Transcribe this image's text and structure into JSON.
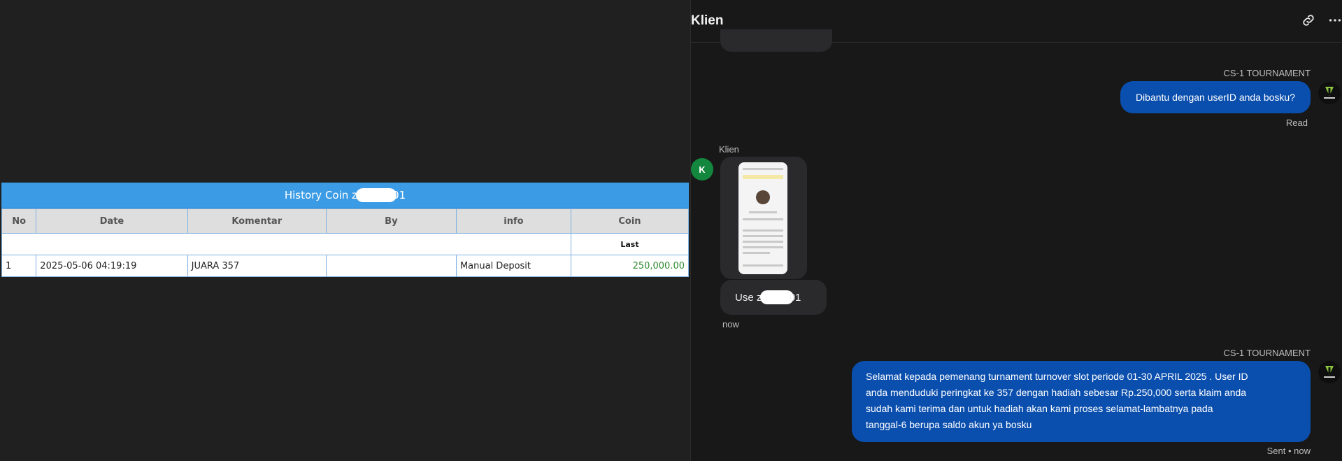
{
  "history": {
    "title_prefix": "History Coin zi",
    "title_suffix": "01",
    "columns": [
      "No",
      "Date",
      "Komentar",
      "By",
      "info",
      "Coin"
    ],
    "subheader": "Last",
    "rows": [
      {
        "no": "1",
        "date": "2025-05-06 04:19:19",
        "komentar": "JUARA 357",
        "by": "",
        "info": "Manual Deposit",
        "coin": "250,000.00"
      }
    ]
  },
  "chat": {
    "title": "Klien",
    "header_icons": [
      "link-icon",
      "more-icon"
    ],
    "messages": [
      {
        "sender": "CS-1 TOURNAMENT",
        "text": "Dibantu dengan userID anda bosku?",
        "status": "Read"
      },
      {
        "sender": "Klien",
        "avatar_letter": "K",
        "attachment": "phone-screenshot-image",
        "text_prefix": "Use zi",
        "text_suffix": "01",
        "time": "now"
      },
      {
        "sender": "CS-1 TOURNAMENT",
        "lines": [
          "Selamat kepada pemenang turnament turnover slot periode 01-30 APRIL 2025 . User ID",
          "anda menduduki peringkat ke 357 dengan hadiah sebesar Rp.250,000 serta klaim anda",
          "sudah kami terima dan untuk hadiah akan kami proses selamat-lambatnya pada",
          "tanggal-6 berupa saldo akun ya bosku"
        ],
        "status": "Sent • now"
      }
    ]
  },
  "colors": {
    "accent_blue": "#3b9be5",
    "bubble_out": "#0b4fae",
    "coin_green": "#2e8b2e",
    "avatar_green": "#14873f"
  }
}
